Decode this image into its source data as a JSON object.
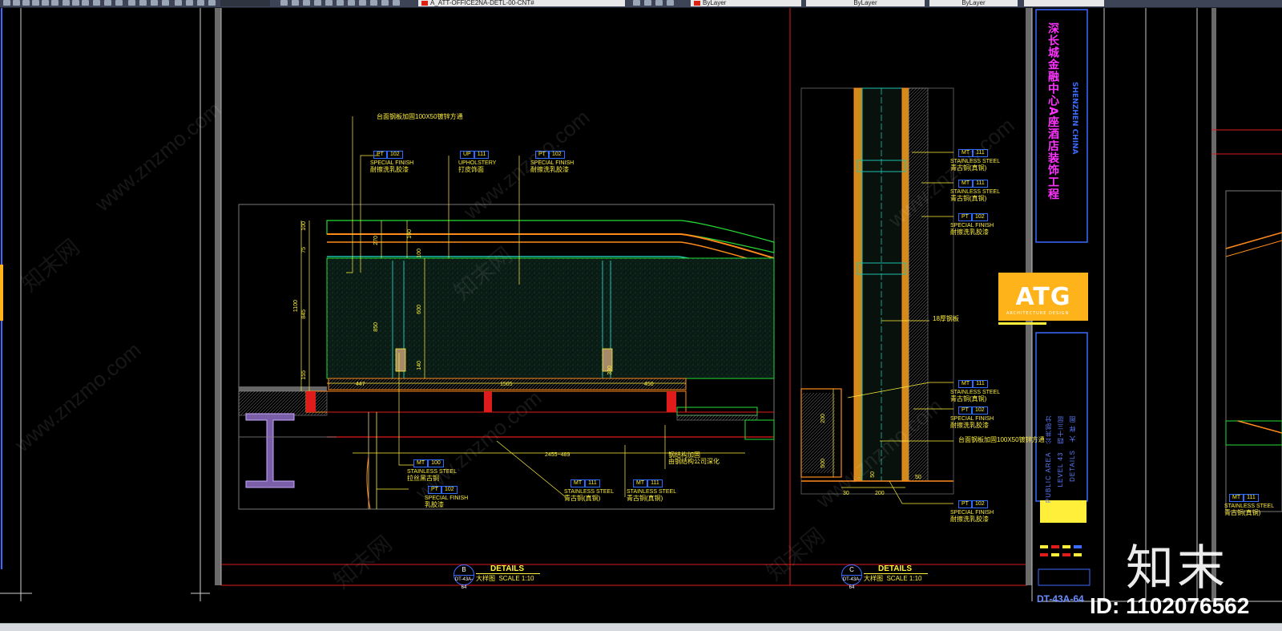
{
  "toolbar": {
    "layer_field": "A_ATT-OFFICE2NA-DETL-00-CNT#",
    "color_field": "ByLayer",
    "linetype_field": "ByLayer",
    "lineweight_field": "ByLayer"
  },
  "detail_b": {
    "circle_top": "B",
    "circle_bottom": "DT-43A-64",
    "title": "DETAILS",
    "subtitle": "大样图",
    "scale_label": "SCALE 1:",
    "scale_value": "10"
  },
  "detail_c": {
    "circle_top": "C",
    "circle_bottom": "DT-43A-64",
    "title": "DETAILS",
    "subtitle": "大样图",
    "scale_label": "SCALE 1:",
    "scale_value": "10"
  },
  "annotations_b": [
    {
      "code": "",
      "tag": "",
      "en": "",
      "cn": "台面钢板加固100X50镀锌方通"
    },
    {
      "code": "PT",
      "tag": "102",
      "en": "SPECIAL FINISH",
      "cn": "耐擦洗乳胶漆"
    },
    {
      "code": "UP",
      "tag": "111",
      "en": "UPHOLSTERY",
      "cn": "打皮饰面"
    },
    {
      "code": "PT",
      "tag": "102",
      "en": "SPECIAL FINISH",
      "cn": "耐擦洗乳胶漆"
    },
    {
      "code": "MT",
      "tag": "100",
      "en": "STAINLESS STEEL",
      "cn": "拉丝黑古铜"
    },
    {
      "code": "PT",
      "tag": "102",
      "en": "SPECIAL FINISH",
      "cn": "乳胶漆"
    },
    {
      "code": "MT",
      "tag": "111",
      "en": "STAINLESS STEEL",
      "cn": "青古铜(真铜)"
    },
    {
      "code": "MT",
      "tag": "111",
      "en": "STAINLESS STEEL",
      "cn": "青古铜(真铜)"
    },
    {
      "code": "",
      "tag": "",
      "en": "",
      "cn": "钢结构加固"
    },
    {
      "code": "",
      "tag": "",
      "en": "",
      "cn": "由钢结构公司深化"
    }
  ],
  "annotations_c": [
    {
      "code": "MT",
      "tag": "111",
      "en": "STAINLESS STEEL",
      "cn": "青古铜(真铜)"
    },
    {
      "code": "MT",
      "tag": "111",
      "en": "STAINLESS STEEL",
      "cn": "青古铜(真铜)"
    },
    {
      "code": "PT",
      "tag": "102",
      "en": "SPECIAL FINISH",
      "cn": "耐擦洗乳胶漆"
    },
    {
      "code": "",
      "tag": "",
      "en": "",
      "cn": "18厚钢板"
    },
    {
      "code": "MT",
      "tag": "111",
      "en": "STAINLESS STEEL",
      "cn": "青古铜(真铜)"
    },
    {
      "code": "PT",
      "tag": "102",
      "en": "SPECIAL FINISH",
      "cn": "耐擦洗乳胶漆"
    },
    {
      "code": "",
      "tag": "",
      "en": "",
      "cn": "台面钢板加固100X50镀锌方通"
    },
    {
      "code": "PT",
      "tag": "102",
      "en": "SPECIAL FINISH",
      "cn": "耐擦洗乳胶漆"
    }
  ],
  "annotations_right": [
    {
      "code": "MT",
      "tag": "111",
      "en": "STAINLESS STEEL",
      "cn": "青古铜(真铜)"
    }
  ],
  "dimensions_b": {
    "d1": "1100",
    "d2": "845",
    "d3": "155",
    "d4": "100",
    "d5": "75",
    "d6": "270",
    "d7": "160",
    "d8": "100",
    "d9": "850",
    "d10": "600",
    "d11": "140",
    "d12": "447",
    "d13": "1505",
    "d14": "450",
    "d15": "2455~489",
    "d16": "330"
  },
  "dimensions_c": {
    "d1": "200",
    "d2": "500",
    "d3": "50",
    "d4": "30",
    "d5": "200",
    "d6": "50"
  },
  "title_block": {
    "project_cn": "深长城金融中心A座酒店装饰工程",
    "project_en": "SHENZHEN CHINA",
    "logo": "ATG",
    "logo_sub": "ARCHITECTURE DESIGN",
    "area_en": "PUBLIC AREA",
    "area_cn": "公共部分",
    "level_en": "LEVEL 43",
    "level_cn": "四十三层",
    "sheet_en": "DETAILS",
    "sheet_cn": "大 样 图",
    "sheet_no": "DT-43A-64"
  },
  "watermark": {
    "brand": "知末",
    "id_label": "ID: 1102076562",
    "url": "www.znzmo.com",
    "cn": "知末网"
  },
  "colors": {
    "background": "#000000",
    "yellow": "#ffef3a",
    "green": "#22dd33",
    "orange": "#ff8a1c",
    "red": "#e01b1b",
    "blue": "#3b6bff",
    "magenta": "#ff33ff",
    "teal": "#1ec0b0",
    "gray": "#8a8a8a"
  }
}
